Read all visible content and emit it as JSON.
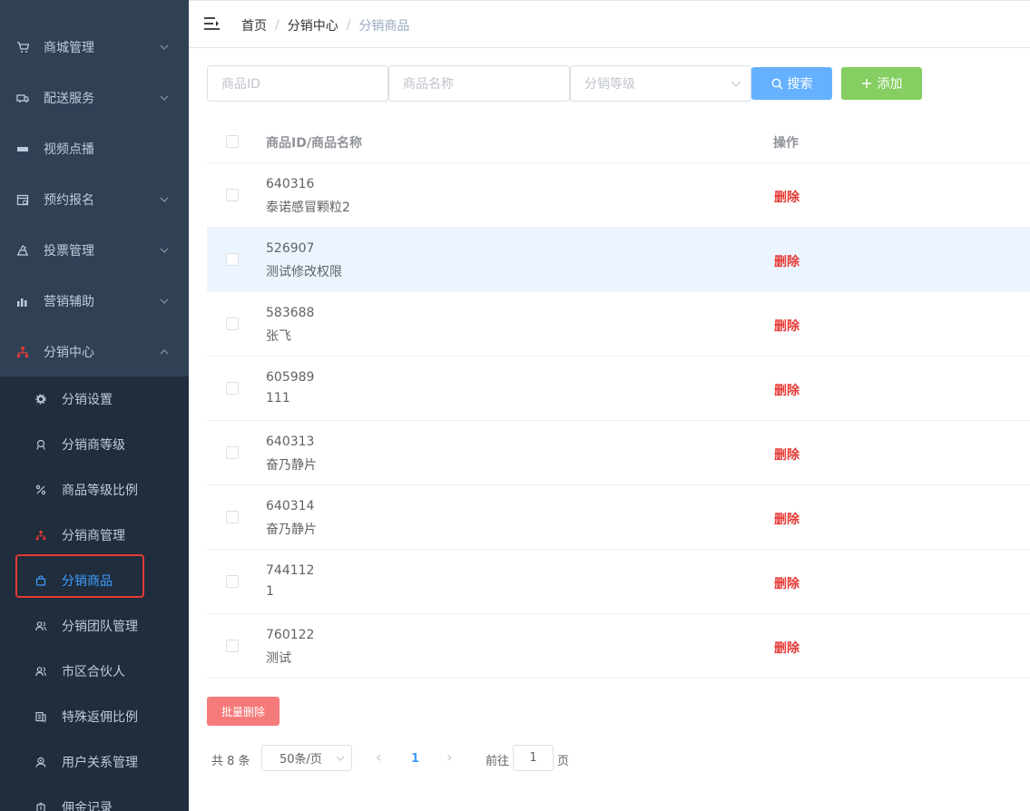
{
  "sidebar": {
    "menu": [
      {
        "label": "商城管理",
        "icon": "cart-icon"
      },
      {
        "label": "配送服务",
        "icon": "truck-icon"
      },
      {
        "label": "视频点播",
        "icon": "video-icon"
      },
      {
        "label": "预约报名",
        "icon": "calendar-icon"
      },
      {
        "label": "投票管理",
        "icon": "vote-icon"
      },
      {
        "label": "营销辅助",
        "icon": "chart-icon"
      },
      {
        "label": "分销中心",
        "icon": "network-icon"
      }
    ],
    "submenu": [
      {
        "label": "分销设置",
        "icon": "gear-icon"
      },
      {
        "label": "分销商等级",
        "icon": "medal-icon"
      },
      {
        "label": "商品等级比例",
        "icon": "percent-icon"
      },
      {
        "label": "分销商管理",
        "icon": "network-icon"
      },
      {
        "label": "分销商品",
        "icon": "bag-icon"
      },
      {
        "label": "分销团队管理",
        "icon": "team-icon"
      },
      {
        "label": "市区合伙人",
        "icon": "team-icon"
      },
      {
        "label": "特殊返佣比例",
        "icon": "coins-icon"
      },
      {
        "label": "用户关系管理",
        "icon": "users-icon"
      },
      {
        "label": "佣金记录",
        "icon": "money-icon"
      }
    ],
    "active_submenu": "分销商品",
    "colors": {
      "bg": "#304156",
      "submenu_bg": "#1f2d3d",
      "text": "#bfcbd9",
      "active": "#409eff",
      "highlight_box": "#e53935"
    }
  },
  "header": {
    "breadcrumb": [
      "首页",
      "分销中心",
      "分销商品"
    ],
    "separator": "/"
  },
  "search": {
    "id_placeholder": "商品ID",
    "name_placeholder": "商品名称",
    "level_placeholder": "分销等级",
    "search_label": "搜索",
    "add_label": "添加"
  },
  "table": {
    "col_name": "商品ID/商品名称",
    "col_op": "操作",
    "rows": [
      {
        "id": "640316",
        "name": "泰诺感冒颗粒2",
        "op": "删除"
      },
      {
        "id": "526907",
        "name": "测试修改权限",
        "op": "删除"
      },
      {
        "id": "583688",
        "name": "张飞",
        "op": "删除"
      },
      {
        "id": "605989",
        "name": "111",
        "op": "删除"
      },
      {
        "id": "640313",
        "name": "奋乃静片",
        "op": "删除"
      },
      {
        "id": "640314",
        "name": "奋乃静片",
        "op": "删除"
      },
      {
        "id": "744112",
        "name": "1",
        "op": "删除"
      },
      {
        "id": "760122",
        "name": "测试",
        "op": "删除"
      }
    ],
    "hovered_row_index": 1
  },
  "batch_delete_label": "批量删除",
  "pagination": {
    "total": "共 8 条",
    "page_size": "50条/页",
    "prev": "‹",
    "current_page": "1",
    "next": "›",
    "goto_label": "前往",
    "goto_value": "1",
    "page_unit": "页"
  }
}
